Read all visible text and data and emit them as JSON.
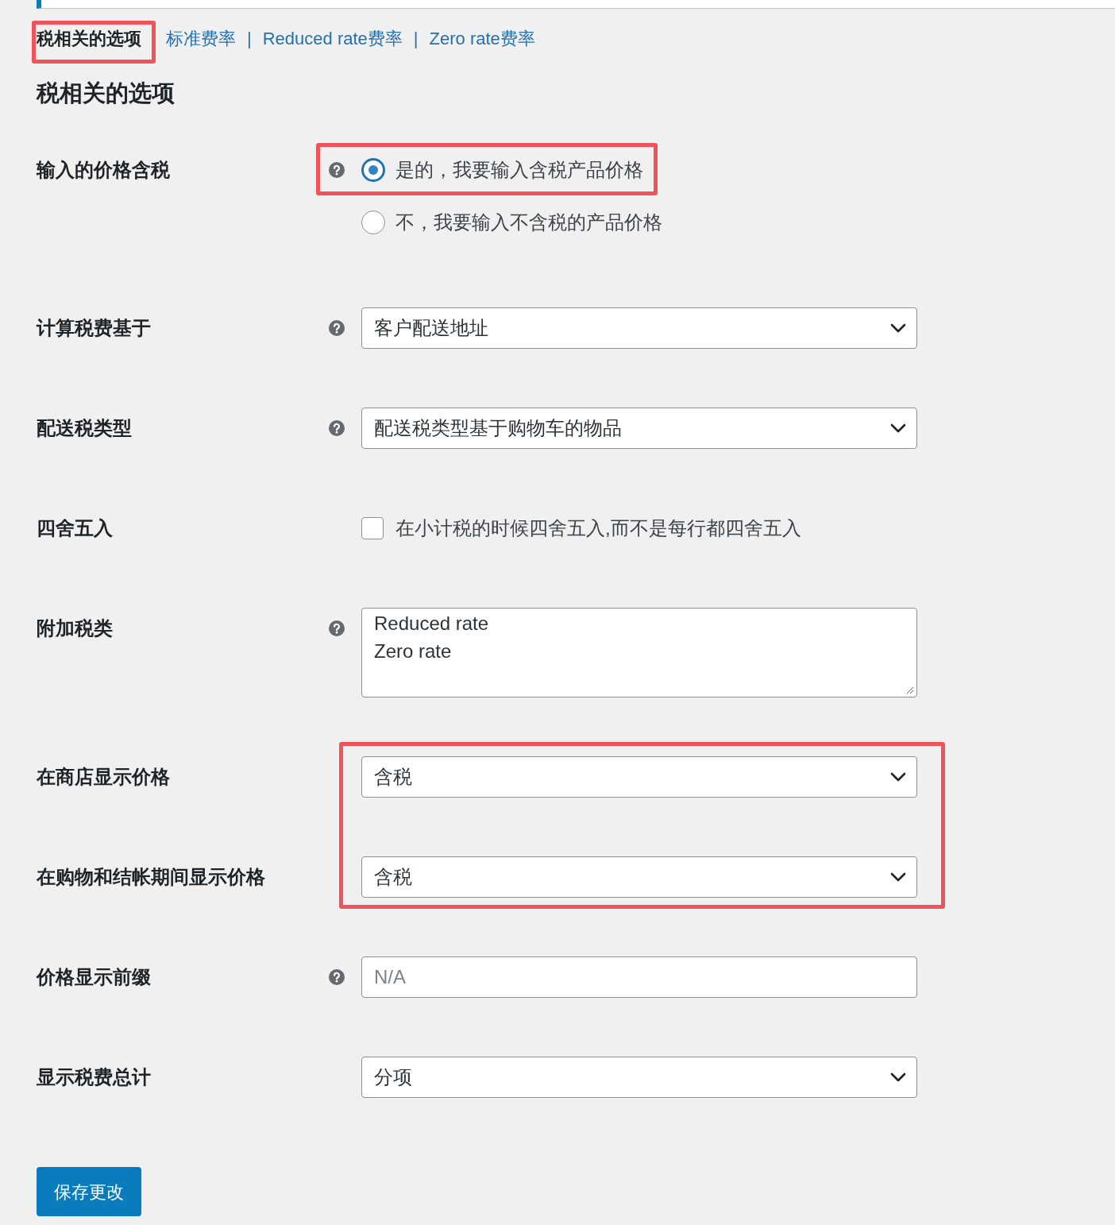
{
  "tabs": [
    {
      "label": "税相关的选项",
      "selected": true,
      "highlighted": true
    },
    {
      "label": "标准费率",
      "selected": false,
      "highlighted": false
    },
    {
      "label": "Reduced rate费率",
      "selected": false,
      "highlighted": false,
      "separator": "|"
    },
    {
      "label": "Zero rate费率",
      "selected": false,
      "highlighted": false,
      "separator": "|"
    }
  ],
  "heading": "税相关的选项",
  "fields": [
    {
      "kind": "radio",
      "label": "输入的价格含税",
      "help": true,
      "highlighted": false,
      "options": [
        {
          "label": "是的，我要输入含税产品价格",
          "selected": true,
          "highlighted": true
        },
        {
          "label": "不，我要输入不含税的产品价格",
          "selected": false,
          "highlighted": false
        }
      ]
    },
    {
      "kind": "select",
      "label": "计算税费基于",
      "help": true,
      "highlighted": false,
      "value": "客户配送地址"
    },
    {
      "kind": "select",
      "label": "配送税类型",
      "help": true,
      "highlighted": false,
      "value": "配送税类型基于购物车的物品"
    },
    {
      "kind": "checkbox",
      "label": "四舍五入",
      "help": false,
      "highlighted": false,
      "checked": false,
      "text": "在小计税的时候四舍五入,而不是每行都四舍五入"
    },
    {
      "kind": "textarea",
      "label": "附加税类",
      "help": true,
      "highlighted": false,
      "value": "Reduced rate\nZero rate"
    },
    {
      "kind": "select",
      "label": "在商店显示价格",
      "help": false,
      "highlighted": true,
      "value": "含税"
    },
    {
      "kind": "select",
      "label": "在购物和结帐期间显示价格",
      "help": false,
      "highlighted": true,
      "value": "含税"
    },
    {
      "kind": "text",
      "label": "价格显示前缀",
      "help": true,
      "highlighted": false,
      "placeholder": "N/A"
    },
    {
      "kind": "select",
      "label": "显示税费总计",
      "help": false,
      "highlighted": false,
      "value": "分项"
    }
  ],
  "save_button": "保存更改"
}
